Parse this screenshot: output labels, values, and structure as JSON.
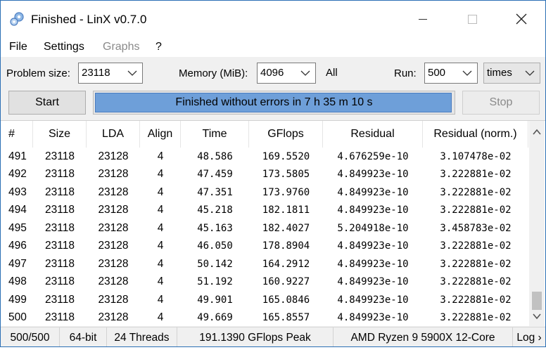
{
  "window": {
    "title": "Finished - LinX v0.7.0"
  },
  "menu": {
    "file": "File",
    "settings": "Settings",
    "graphs": "Graphs",
    "help": "?"
  },
  "toolbar": {
    "problem_label": "Problem size:",
    "problem_value": "23118",
    "memory_label": "Memory (MiB):",
    "memory_value": "4096",
    "all_label": "All",
    "run_label": "Run:",
    "run_value": "500",
    "times_value": "times",
    "start_label": "Start",
    "stop_label": "Stop",
    "progress_text": "Finished without errors in 7 h 35 m 10 s",
    "progress_fraction": 1.0
  },
  "table": {
    "columns": [
      "#",
      "Size",
      "LDA",
      "Align",
      "Time",
      "GFlops",
      "Residual",
      "Residual (norm.)"
    ],
    "rows": [
      [
        "491",
        "23118",
        "23128",
        "4",
        "48.586",
        "169.5520",
        "4.676259e-10",
        "3.107478e-02"
      ],
      [
        "492",
        "23118",
        "23128",
        "4",
        "47.459",
        "173.5805",
        "4.849923e-10",
        "3.222881e-02"
      ],
      [
        "493",
        "23118",
        "23128",
        "4",
        "47.351",
        "173.9760",
        "4.849923e-10",
        "3.222881e-02"
      ],
      [
        "494",
        "23118",
        "23128",
        "4",
        "45.218",
        "182.1811",
        "4.849923e-10",
        "3.222881e-02"
      ],
      [
        "495",
        "23118",
        "23128",
        "4",
        "45.163",
        "182.4027",
        "5.204918e-10",
        "3.458783e-02"
      ],
      [
        "496",
        "23118",
        "23128",
        "4",
        "46.050",
        "178.8904",
        "4.849923e-10",
        "3.222881e-02"
      ],
      [
        "497",
        "23118",
        "23128",
        "4",
        "50.142",
        "164.2912",
        "4.849923e-10",
        "3.222881e-02"
      ],
      [
        "498",
        "23118",
        "23128",
        "4",
        "51.192",
        "160.9227",
        "4.849923e-10",
        "3.222881e-02"
      ],
      [
        "499",
        "23118",
        "23128",
        "4",
        "49.901",
        "165.0846",
        "4.849923e-10",
        "3.222881e-02"
      ],
      [
        "500",
        "23118",
        "23128",
        "4",
        "49.669",
        "165.8557",
        "4.849923e-10",
        "3.222881e-02"
      ]
    ]
  },
  "status": {
    "runs": "500/500",
    "bits": "64-bit",
    "threads": "24 Threads",
    "peak": "191.1390 GFlops Peak",
    "cpu": "AMD Ryzen 9 5900X 12-Core",
    "log": "Log ›"
  },
  "icons": {
    "app": "gears-icon",
    "minimize": "minimize-icon",
    "maximize": "maximize-icon",
    "close": "close-icon",
    "dropdown": "chevron-down-icon",
    "scroll_up": "scroll-up-icon",
    "scroll_down": "scroll-down-icon"
  },
  "colors": {
    "progress_fill": "#6e9fd9",
    "window_border": "#2b6fb5",
    "disabled_text": "#8a8a8a"
  }
}
